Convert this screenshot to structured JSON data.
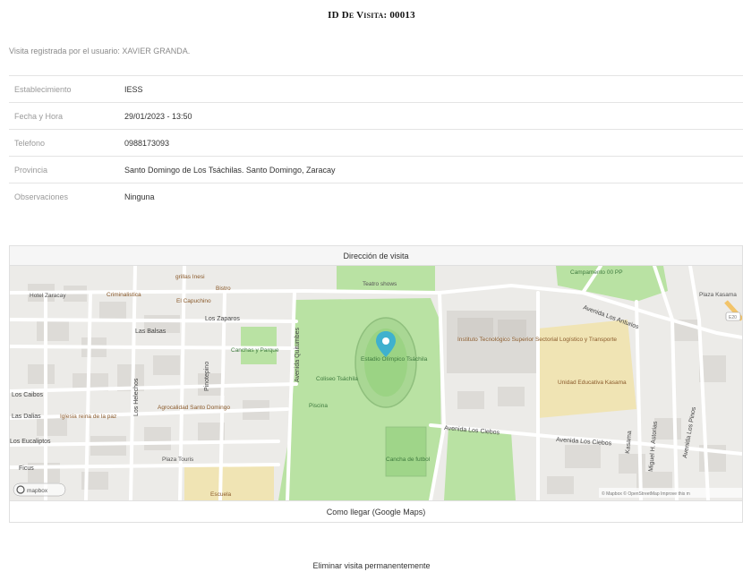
{
  "header": {
    "visit_id_title": "ID De Visita: 00013",
    "registered_by": "Visita registrada por el usuario: XAVIER GRANDA."
  },
  "details": [
    {
      "label": "Establecimiento",
      "value": "IESS"
    },
    {
      "label": "Fecha y Hora",
      "value": "29/01/2023 - 13:50"
    },
    {
      "label": "Telefono",
      "value": "0988173093"
    },
    {
      "label": "Provincia",
      "value": "Santo Domingo de Los Tsáchilas. Santo Domingo, Zaracay"
    },
    {
      "label": "Observaciones",
      "value": "Ninguna"
    }
  ],
  "map": {
    "header_label": "Dirección de visita",
    "footer_link": "Como llegar (Google Maps)",
    "attribution": "© Mapbox © OpenStreetMap Improve this m",
    "logo_text": "mapbox",
    "labels": {
      "hotel": "Hotel Zaracay",
      "criminalistica": "Criminalistica",
      "grillas": "grillas Inesi",
      "bistro": "Bistro",
      "capuchino": "El Capuchino",
      "teatro": "Teatro shows",
      "campamento": "Campamento 00 PP",
      "plaza_kasama": "Plaza Kasama",
      "los_zaparos": "Los Zaparos",
      "las_balsas": "Las Balsas",
      "canchas": "Canchas y Parque",
      "av_quitumbes": "Avenida Quitumbes",
      "estadio": "Estadio Olímpico Tsáchila",
      "instituto": "Instituto Tecnológico Superior Sectorial Logístico y Transporte",
      "av_los_anturios": "Avenida Los Anturios",
      "coliseo": "Coliseo Tsáchila",
      "unidad": "Unidad Educativa Kasama",
      "piscina": "Piscina",
      "los_caibos": "Los Caibos",
      "las_dalias": "Las Dalias",
      "iglesia": "Iglesia reina de la paz",
      "agrocalidad": "Agrocalidad Santo Domingo",
      "los_helechos": "Los Helechos",
      "pinotepino": "Pinotepino",
      "eucaliptos": "Los Eucaliptos",
      "ficus": "Ficus",
      "plaza_touris": "Plaza Touris",
      "escuela": "Escuela",
      "cancha_futbol": "Cancha de futbol",
      "av_los_ciebos_1": "Avenida Los Ciebos",
      "av_los_ciebos_2": "Avenida Los Ciebos",
      "kasama_st": "Kasama",
      "miguel": "Miguel H. Astorias",
      "los_pinos": "Avenida Los Pinos",
      "e20": "E20"
    }
  },
  "actions": {
    "delete_label": "Eliminar visita permanentemente"
  },
  "colors": {
    "map_base": "#ecebe8",
    "park_green": "#b9e2a3",
    "stadium_green": "#9bd384",
    "school_yellow": "#f0e4b4",
    "marker_blue": "#3fb1ce",
    "motorway_yellow": "#f2c46a"
  }
}
